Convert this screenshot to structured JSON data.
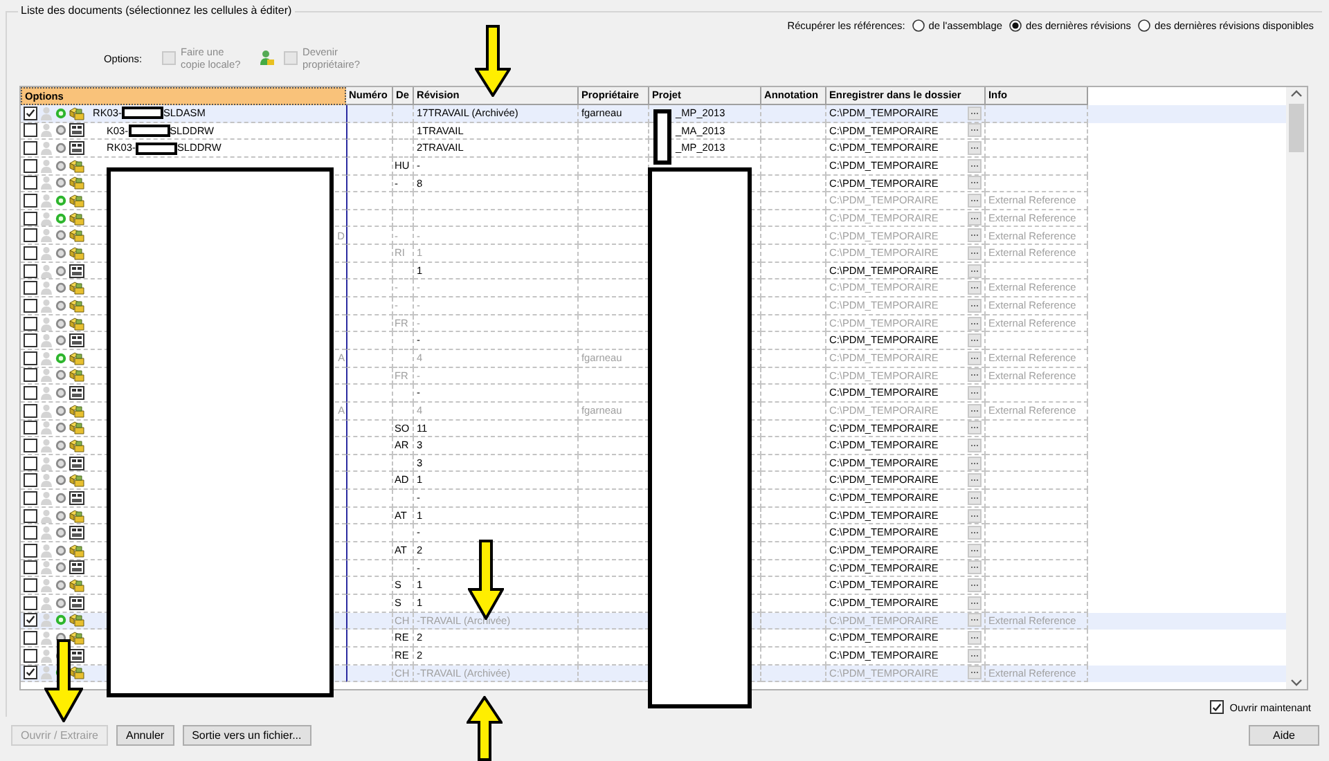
{
  "group_title": "Liste des documents (sélectionnez les cellules à éditer)",
  "references": {
    "label": "Récupérer les références:",
    "options": [
      {
        "label": "de l'assemblage",
        "selected": false
      },
      {
        "label": "des dernières révisions",
        "selected": true
      },
      {
        "label": "des dernières révisions disponibles",
        "selected": false
      }
    ]
  },
  "options": {
    "label": "Options:",
    "items": [
      {
        "label": "Faire une copie locale?",
        "checked": false,
        "disabled": true,
        "kind": "plain"
      },
      {
        "label": "Devenir propriétaire?",
        "checked": false,
        "disabled": true,
        "kind": "owner"
      }
    ]
  },
  "table": {
    "columns": [
      "Options",
      "Numéro",
      "De",
      "Révision",
      "Propriétaire",
      "Projet",
      "Annotation",
      "Enregistrer dans le dossier",
      "Info"
    ],
    "rows": [
      {
        "checked": true,
        "selected": true,
        "active": true,
        "kind": "assembly",
        "dimmed": false,
        "name_start": "RK03-",
        "name_end": "SLDASM",
        "revision": "17TRAVAIL (Archivée)",
        "owner": "fgarneau",
        "project": "_MP_2013",
        "folder": "C:\\PDM_TEMPORAIRE",
        "children": [
          {
            "checked": false,
            "selected": false,
            "active": false,
            "kind": "drawing",
            "dimmed": false,
            "name_start": "K03-",
            "name_end": "SLDDRW",
            "revision": "1TRAVAIL",
            "project": "_MA_2013",
            "folder": "C:\\PDM_TEMPORAIRE"
          },
          {
            "checked": false,
            "selected": false,
            "active": false,
            "kind": "drawing",
            "dimmed": false,
            "name_start": "RK03-",
            "name_end": "SLDDRW",
            "revision": "2TRAVAIL",
            "project": "_MP_2013",
            "folder": "C:\\PDM_TEMPORAIRE"
          }
        ]
      },
      {
        "checked": false,
        "selected": false,
        "active": false,
        "kind": "assembly",
        "dimmed": false,
        "de": "HU",
        "revision": "-",
        "folder": "C:\\PDM_TEMPORAIRE"
      },
      {
        "checked": false,
        "selected": false,
        "active": false,
        "kind": "assembly",
        "dimmed": false,
        "de": "-",
        "revision": "8",
        "folder": "C:\\PDM_TEMPORAIRE"
      },
      {
        "checked": false,
        "selected": false,
        "active": true,
        "kind": "assembly",
        "dimmed": true,
        "folder": "C:\\PDM_TEMPORAIRE",
        "info": "External Reference"
      },
      {
        "checked": false,
        "selected": false,
        "active": true,
        "kind": "assembly",
        "dimmed": true,
        "folder": "C:\\PDM_TEMPORAIRE",
        "info": "External Reference"
      },
      {
        "checked": false,
        "selected": false,
        "active": false,
        "kind": "assembly",
        "dimmed": true,
        "name_fragment": "D",
        "de": "-",
        "revision": "-",
        "folder": "C:\\PDM_TEMPORAIRE",
        "info": "External Reference"
      },
      {
        "checked": false,
        "selected": false,
        "active": false,
        "kind": "assembly",
        "dimmed": true,
        "de": "RI",
        "revision": "1",
        "folder": "C:\\PDM_TEMPORAIRE",
        "info": "External Reference"
      },
      {
        "checked": false,
        "selected": false,
        "active": false,
        "kind": "drawing",
        "dimmed": false,
        "revision": "1",
        "folder": "C:\\PDM_TEMPORAIRE"
      },
      {
        "checked": false,
        "selected": false,
        "active": false,
        "kind": "assembly",
        "dimmed": true,
        "de": "-",
        "revision": "-",
        "folder": "C:\\PDM_TEMPORAIRE",
        "info": "External Reference"
      },
      {
        "checked": false,
        "selected": false,
        "active": false,
        "kind": "assembly",
        "dimmed": true,
        "de": "-",
        "revision": "-",
        "folder": "C:\\PDM_TEMPORAIRE",
        "info": "External Reference"
      },
      {
        "checked": false,
        "selected": false,
        "active": false,
        "kind": "assembly",
        "dimmed": true,
        "de": "FR",
        "revision": "-",
        "folder": "C:\\PDM_TEMPORAIRE",
        "info": "External Reference"
      },
      {
        "checked": false,
        "selected": false,
        "active": false,
        "kind": "drawing",
        "dimmed": false,
        "revision": "-",
        "folder": "C:\\PDM_TEMPORAIRE"
      },
      {
        "checked": false,
        "selected": false,
        "active": true,
        "kind": "assembly",
        "dimmed": true,
        "name_fragment": "A",
        "revision": "4",
        "owner": "fgarneau",
        "folder": "C:\\PDM_TEMPORAIRE",
        "info": "External Reference"
      },
      {
        "checked": false,
        "selected": false,
        "active": false,
        "kind": "assembly",
        "dimmed": true,
        "de": "FR",
        "revision": "-",
        "folder": "C:\\PDM_TEMPORAIRE",
        "info": "External Reference"
      },
      {
        "checked": false,
        "selected": false,
        "active": false,
        "kind": "drawing",
        "dimmed": false,
        "revision": "-",
        "folder": "C:\\PDM_TEMPORAIRE"
      },
      {
        "checked": false,
        "selected": false,
        "active": false,
        "kind": "assembly",
        "dimmed": true,
        "name_fragment": "A",
        "revision": "4",
        "owner": "fgarneau",
        "folder": "C:\\PDM_TEMPORAIRE",
        "info": "External Reference"
      },
      {
        "checked": false,
        "selected": false,
        "active": false,
        "kind": "assembly",
        "dimmed": false,
        "de": "SO",
        "revision": "11",
        "folder": "C:\\PDM_TEMPORAIRE"
      },
      {
        "checked": false,
        "selected": false,
        "active": false,
        "kind": "assembly",
        "dimmed": false,
        "de": "AR",
        "revision": "3",
        "folder": "C:\\PDM_TEMPORAIRE"
      },
      {
        "checked": false,
        "selected": false,
        "active": false,
        "kind": "drawing",
        "dimmed": false,
        "revision": "3",
        "folder": "C:\\PDM_TEMPORAIRE"
      },
      {
        "checked": false,
        "selected": false,
        "active": false,
        "kind": "assembly",
        "dimmed": false,
        "de": "AD",
        "revision": "1",
        "folder": "C:\\PDM_TEMPORAIRE"
      },
      {
        "checked": false,
        "selected": false,
        "active": false,
        "kind": "drawing",
        "dimmed": false,
        "revision": "-",
        "folder": "C:\\PDM_TEMPORAIRE"
      },
      {
        "checked": false,
        "selected": false,
        "active": false,
        "kind": "assembly",
        "dimmed": false,
        "de": "AT",
        "revision": "1",
        "folder": "C:\\PDM_TEMPORAIRE"
      },
      {
        "checked": false,
        "selected": false,
        "active": false,
        "kind": "drawing",
        "dimmed": false,
        "revision": "-",
        "folder": "C:\\PDM_TEMPORAIRE"
      },
      {
        "checked": false,
        "selected": false,
        "active": false,
        "kind": "assembly",
        "dimmed": false,
        "de": "AT",
        "revision": "2",
        "folder": "C:\\PDM_TEMPORAIRE"
      },
      {
        "checked": false,
        "selected": false,
        "active": false,
        "kind": "drawing",
        "dimmed": false,
        "revision": "-",
        "folder": "C:\\PDM_TEMPORAIRE"
      },
      {
        "checked": false,
        "selected": false,
        "active": false,
        "kind": "assembly",
        "dimmed": false,
        "de": "S",
        "revision": "1",
        "folder": "C:\\PDM_TEMPORAIRE"
      },
      {
        "checked": false,
        "selected": false,
        "active": false,
        "kind": "drawing",
        "dimmed": false,
        "de": "S",
        "revision": "1",
        "folder": "C:\\PDM_TEMPORAIRE"
      },
      {
        "checked": true,
        "selected": true,
        "active": true,
        "kind": "assembly",
        "dimmed": true,
        "de": "CH",
        "revision": "-TRAVAIL (Archivée)",
        "folder": "C:\\PDM_TEMPORAIRE",
        "info": "External Reference"
      },
      {
        "checked": false,
        "selected": false,
        "active": false,
        "kind": "assembly",
        "dimmed": false,
        "de": "RE",
        "revision": "2",
        "folder": "C:\\PDM_TEMPORAIRE"
      },
      {
        "checked": false,
        "selected": false,
        "active": false,
        "kind": "drawing",
        "dimmed": false,
        "de": "RE",
        "revision": "2",
        "folder": "C:\\PDM_TEMPORAIRE"
      },
      {
        "checked": true,
        "selected": true,
        "active": true,
        "kind": "assembly",
        "dimmed": true,
        "de": "CH",
        "revision": "-TRAVAIL (Archivée)",
        "folder": "C:\\PDM_TEMPORAIRE",
        "info": "External Reference"
      }
    ]
  },
  "open_now": {
    "label": "Ouvrir maintenant",
    "checked": true
  },
  "buttons": [
    {
      "label": "Ouvrir / Extraire",
      "disabled": true
    },
    {
      "label": "Annuler",
      "disabled": false
    },
    {
      "label": "Sortie vers un fichier...",
      "disabled": false
    }
  ],
  "help_button": {
    "label": "Aide",
    "disabled": false
  }
}
